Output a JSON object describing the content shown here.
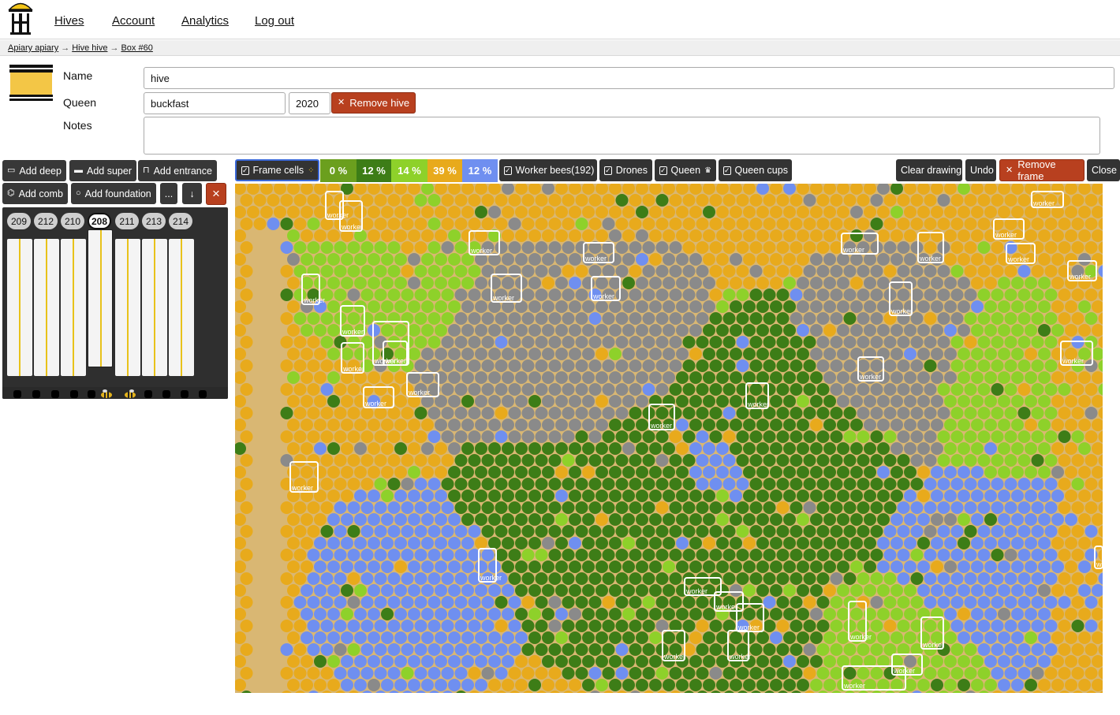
{
  "nav": {
    "links": [
      "Hives",
      "Account",
      "Analytics",
      "Log out"
    ]
  },
  "breadcrumb": {
    "items": [
      "Apiary apiary",
      "Hive hive",
      "Box #60"
    ],
    "separator": "→"
  },
  "hive_form": {
    "name_label": "Name",
    "name_value": "hive",
    "queen_label": "Queen",
    "queen_race_value": "buckfast",
    "queen_year_value": "2020",
    "remove_hive_label": "Remove hive",
    "notes_label": "Notes",
    "notes_value": ""
  },
  "box_toolbar": {
    "add_deep": "Add deep",
    "add_super": "Add super",
    "add_entrance": "Add entrance",
    "add_comb": "Add comb",
    "add_foundation": "Add foundation",
    "more": "...",
    "down": "↓",
    "delete": "×"
  },
  "frames": {
    "tabs": [
      "209",
      "212",
      "210",
      "208",
      "211",
      "213",
      "214"
    ],
    "active": "208"
  },
  "frame_toolbar": {
    "frame_cells": "Frame cells",
    "percentages": [
      {
        "label": "0 %",
        "color": "#6b9f1e"
      },
      {
        "label": "12 %",
        "color": "#3d7d17"
      },
      {
        "label": "14 %",
        "color": "#8ed12a"
      },
      {
        "label": "39 %",
        "color": "#e8aa1c"
      },
      {
        "label": "12 %",
        "color": "#6f8ff0"
      }
    ],
    "worker_bees": "Worker bees(192)",
    "drones": "Drones",
    "queen": "Queen",
    "queen_cups": "Queen cups",
    "clear_drawing": "Clear drawing",
    "undo": "Undo",
    "remove_frame": "Remove frame",
    "close": "Close"
  },
  "detections": {
    "label": "worker"
  },
  "colors": {
    "danger": "#b8401f",
    "dark_button": "#383838",
    "honey": "#e8aa1c",
    "capped_brood": "#3d7d17",
    "open_brood": "#8ed12a",
    "pollen": "#6f8ff0",
    "empty": "#8a8a8a"
  }
}
